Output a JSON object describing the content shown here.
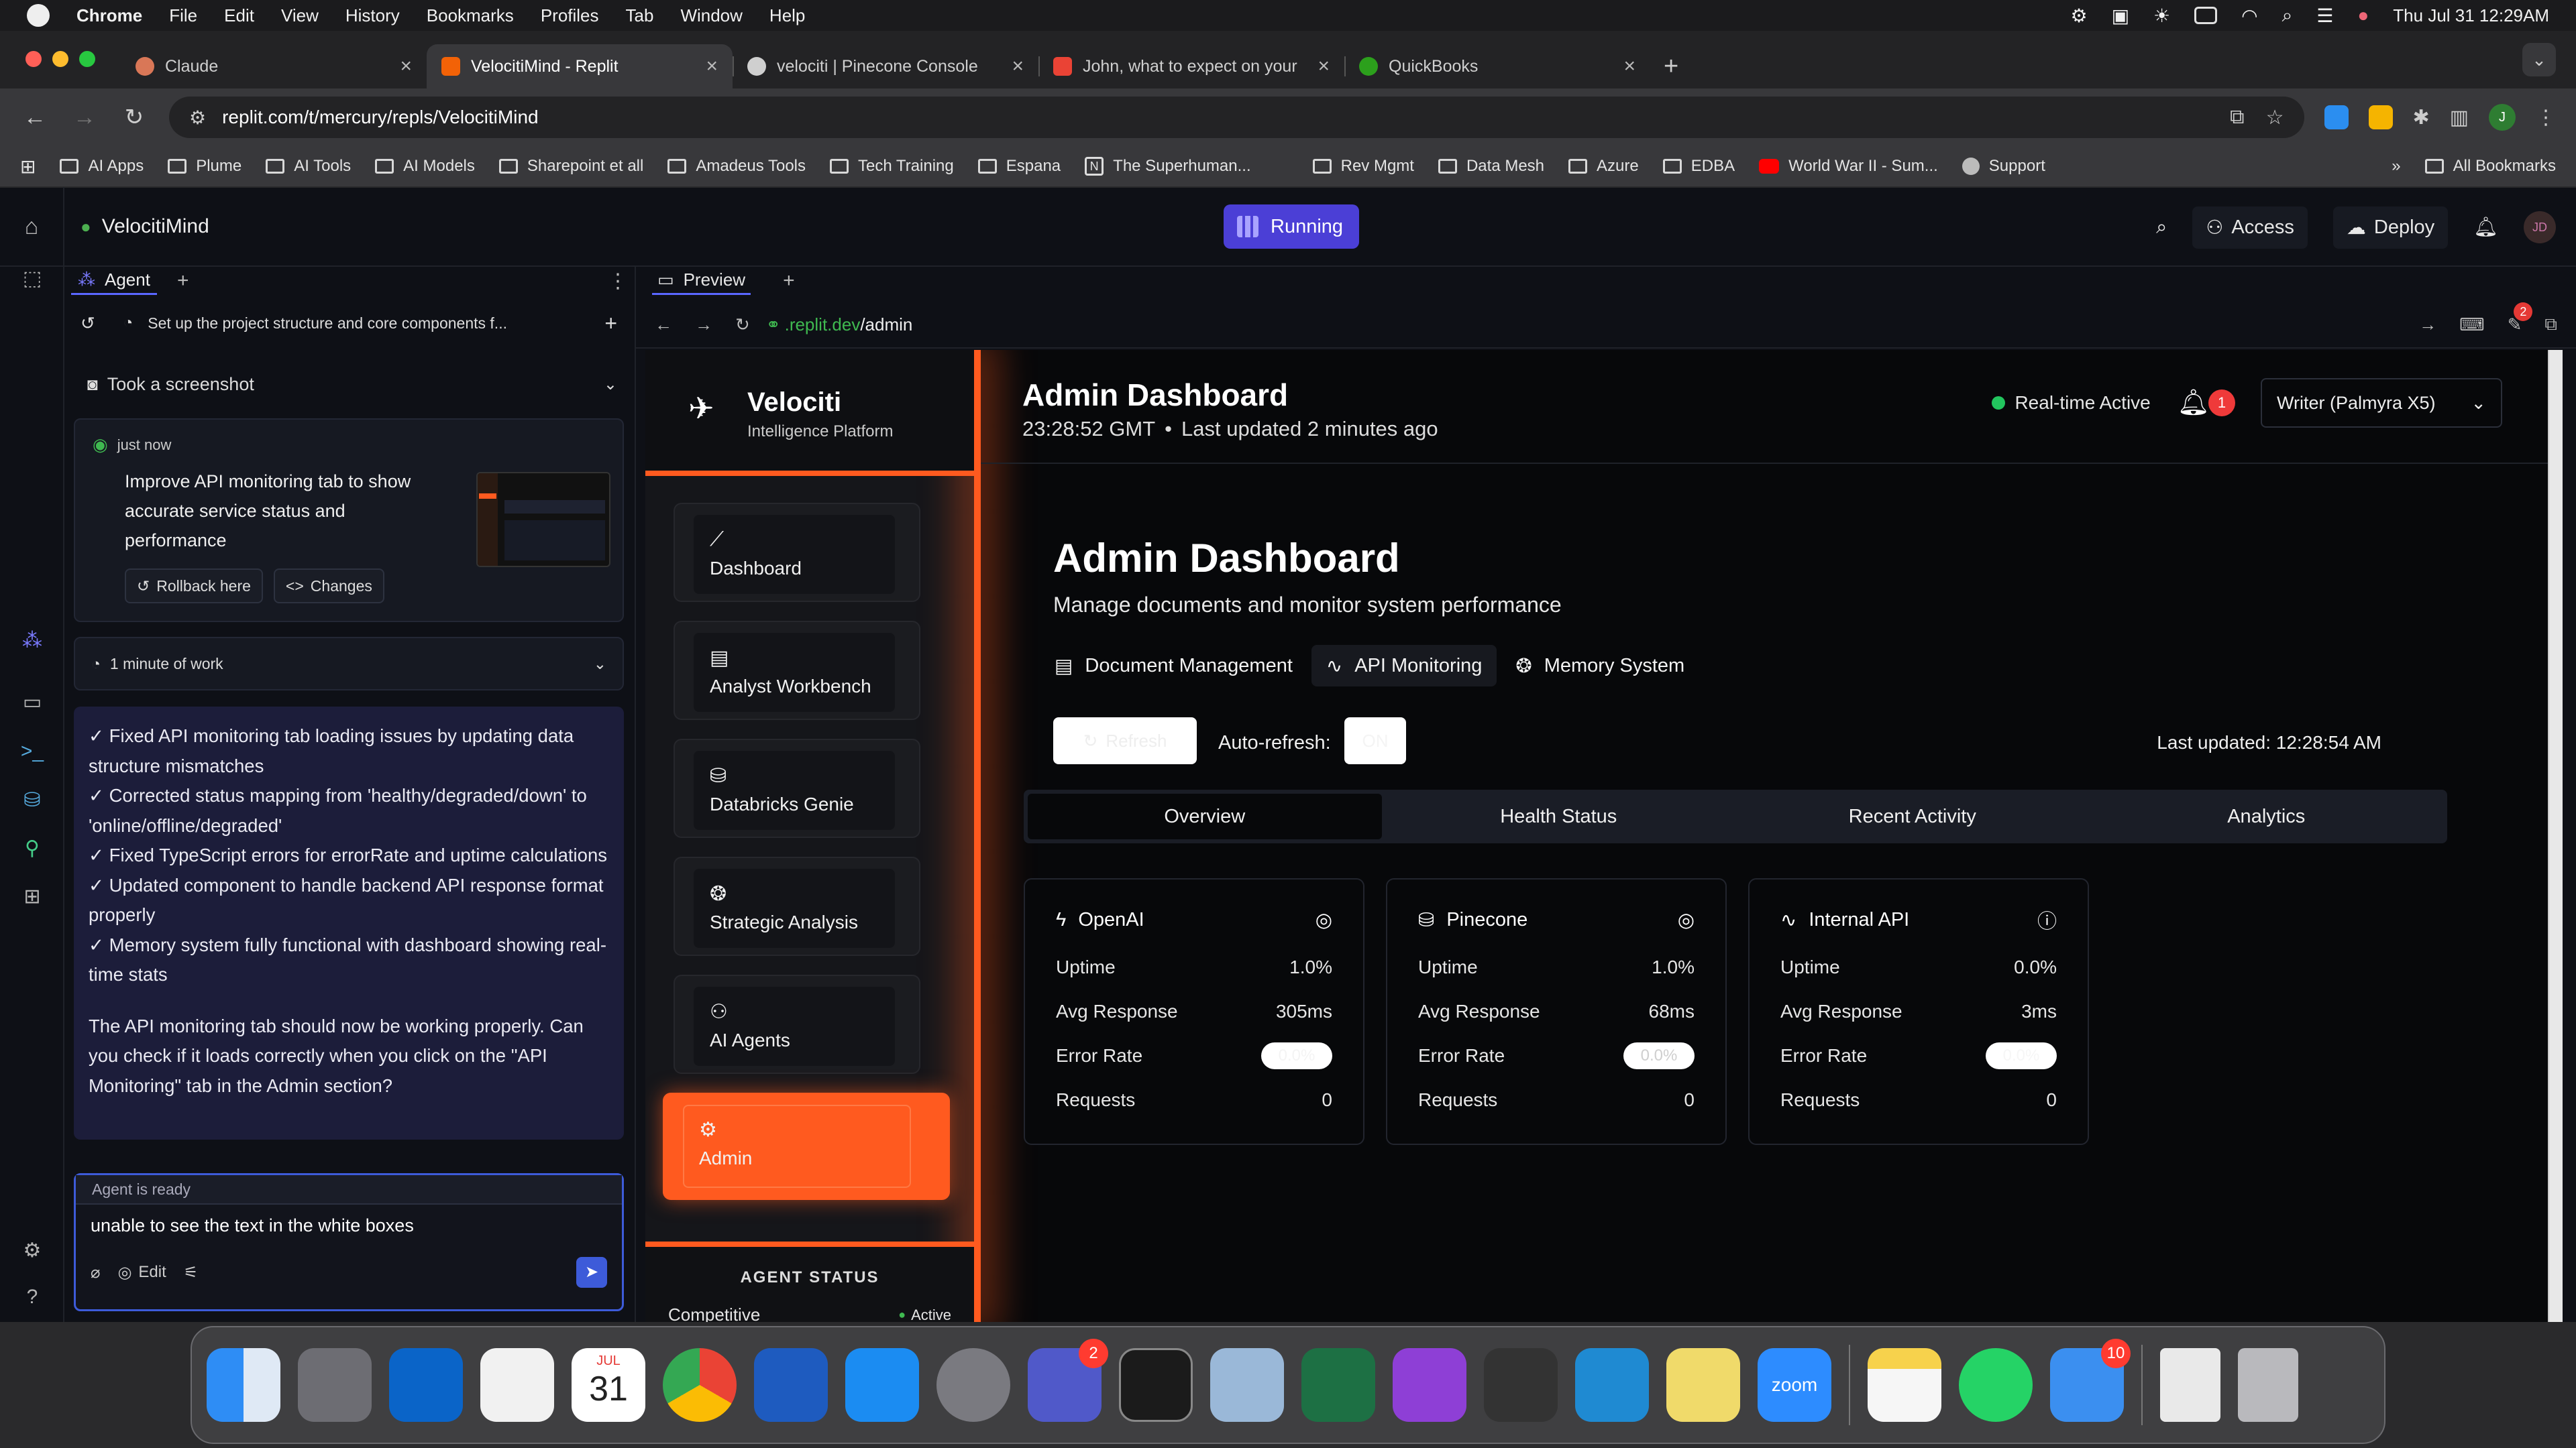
{
  "menubar": {
    "app": "Chrome",
    "items": [
      "File",
      "Edit",
      "View",
      "History",
      "Bookmarks",
      "Profiles",
      "Tab",
      "Window",
      "Help"
    ],
    "clock": "Thu Jul 31  12:29AM"
  },
  "browser_tabs": [
    {
      "title": "Claude",
      "color": "#d97757"
    },
    {
      "title": "VelocitiMind - Replit",
      "color": "#f26207"
    },
    {
      "title": "velociti | Pinecone Console",
      "color": "#cfcfcf"
    },
    {
      "title": "John, what to expect on your",
      "color": "#ea4335"
    },
    {
      "title": "QuickBooks",
      "color": "#2ca01c"
    }
  ],
  "address": {
    "url": "replit.com/t/mercury/repls/VelocitiMind"
  },
  "bookmarks": [
    "AI Apps",
    "Plume",
    "AI Tools",
    "AI Models",
    "Sharepoint et all",
    "Amadeus Tools",
    "Tech Training",
    "Espana",
    "The Superhuman...",
    "Rev Mgmt",
    "Data Mesh",
    "Azure",
    "EDBA",
    "World War II - Sum...",
    "Support"
  ],
  "bookmarks_all": "All Bookmarks",
  "replit": {
    "project": "VelocitiMind",
    "status": "Running",
    "access": "Access",
    "deploy": "Deploy",
    "avatar": "JD"
  },
  "agent": {
    "tab": "Agent",
    "task": "Set up the project structure and core components f...",
    "screenshot": "Took a screenshot",
    "checkpoint_time": "just now",
    "checkpoint_text": "Improve API monitoring tab to show accurate service status and performance",
    "rollback": "Rollback here",
    "changes": "Changes",
    "work": "1 minute of work",
    "summary_lines": [
      "✓ Fixed API monitoring tab loading issues by updating data structure mismatches",
      "✓ Corrected status mapping from 'healthy/degraded/down' to 'online/offline/degraded'",
      "✓ Fixed TypeScript errors for errorRate and uptime calculations",
      "✓ Updated component to handle backend API response format properly",
      "✓ Memory system fully functional with dashboard showing real-time stats"
    ],
    "summary_question": "The API monitoring tab should now be working properly. Can you check if it loads correctly when you click on the \"API Monitoring\" tab in the Admin section?",
    "ready": "Agent is ready",
    "input": "unable to see the text in the white boxes",
    "edit": "Edit"
  },
  "preview": {
    "tab": "Preview",
    "url_domain": ".replit.dev",
    "url_path": "/admin",
    "notif_count": "2"
  },
  "app": {
    "brand": "Velociti",
    "brand_sub": "Intelligence Platform",
    "nav": [
      "Dashboard",
      "Analyst Workbench",
      "Databricks Genie",
      "Strategic Analysis",
      "AI Agents",
      "Admin"
    ],
    "agent_status_title": "AGENT STATUS",
    "agent_status_name": "Competitive",
    "agent_status_value": "Active",
    "header_title": "Admin Dashboard",
    "header_time": "23:28:52 GMT",
    "header_updated": "Last updated 2 minutes ago",
    "realtime": "Real-time Active",
    "bell_count": "1",
    "model_select": "Writer (Palmyra X5)",
    "page_title": "Admin Dashboard",
    "page_subtitle": "Manage documents and monitor system performance",
    "tabs": [
      "Document Management",
      "API Monitoring",
      "Memory System"
    ],
    "refresh": "Refresh",
    "auto_refresh_label": "Auto-refresh:",
    "auto_refresh_value": "ON",
    "last_updated": "Last updated: 12:28:54 AM",
    "subtabs": [
      "Overview",
      "Health Status",
      "Recent Activity",
      "Analytics"
    ],
    "services": [
      {
        "name": "OpenAI",
        "uptime": "1.0%",
        "avg": "305ms",
        "error": "0.0%",
        "requests": "0",
        "status_icon": "check-circle-icon"
      },
      {
        "name": "Pinecone",
        "uptime": "1.0%",
        "avg": "68ms",
        "error": "0.0%",
        "requests": "0",
        "status_icon": "check-circle-icon"
      },
      {
        "name": "Internal API",
        "uptime": "0.0%",
        "avg": "3ms",
        "error": "0.0%",
        "requests": "0",
        "status_icon": "alert-circle-icon"
      }
    ],
    "labels": {
      "uptime": "Uptime",
      "avg": "Avg Response",
      "error": "Error Rate",
      "requests": "Requests"
    }
  },
  "dock": {
    "apps": [
      "Finder",
      "Launchpad",
      "Outlook",
      "TextEdit",
      "Calendar",
      "Chrome",
      "Word",
      "App Store",
      "System Settings",
      "Teams",
      "Terminal",
      "Preview",
      "Excel",
      "Podcasts",
      "Calculator",
      "VS Code",
      "Stickies",
      "Zoom",
      "Notes",
      "WhatsApp",
      "Mail",
      "Document",
      "Trash"
    ],
    "calendar_month": "JUL",
    "calendar_day": "31",
    "teams_badge": "2",
    "mail_badge": "10",
    "zoom_label": "zoom"
  }
}
